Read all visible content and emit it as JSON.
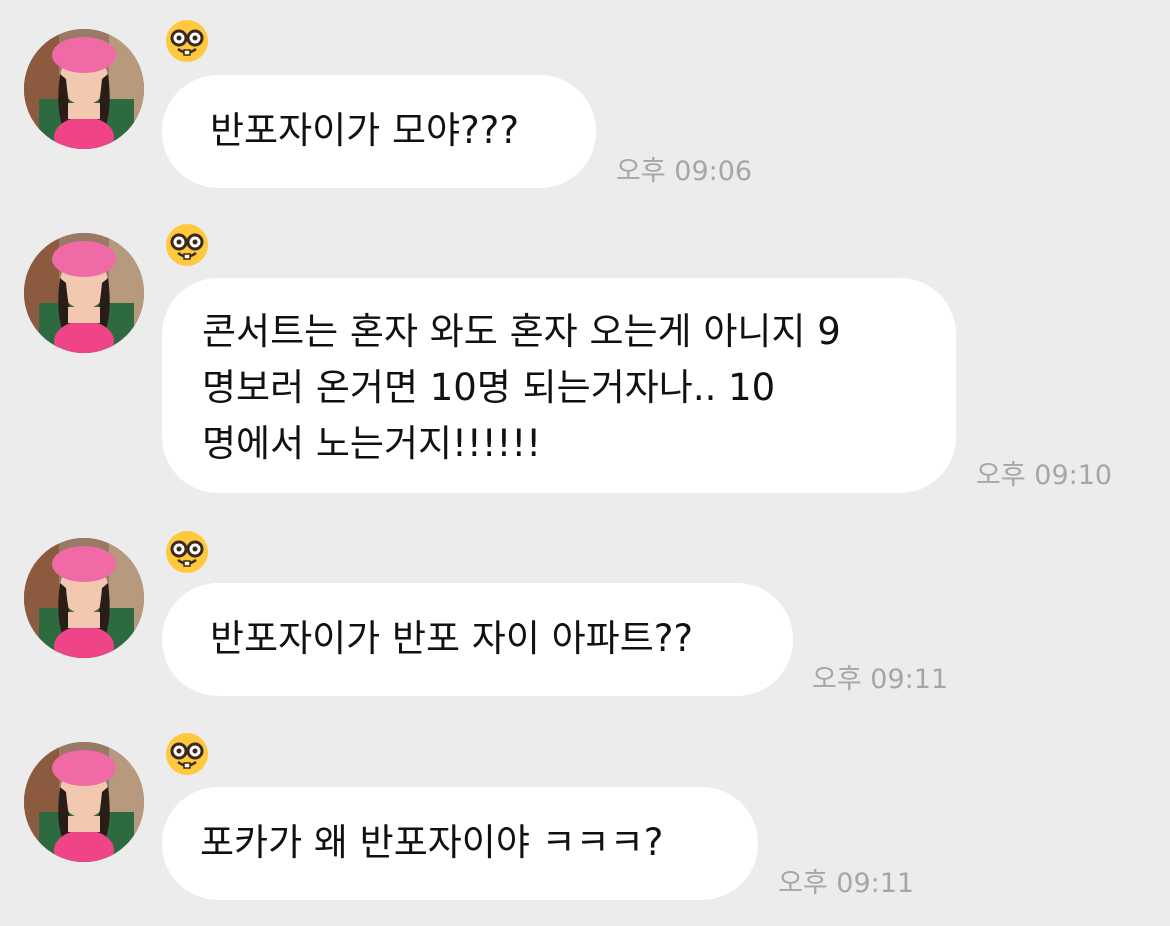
{
  "sender": {
    "emoji_icon": "nerd-face-icon",
    "avatar_icon": "profile-photo-avatar"
  },
  "messages": [
    {
      "text": "반포자이가 모야???",
      "time": "오후 09:06"
    },
    {
      "text": "콘서트는 혼자 와도 혼자 오는게 아니지 9\n명보러 온거면 10명 되는거자나.. 10\n명에서 노는거지!!!!!!",
      "time": "오후 09:10"
    },
    {
      "text": "반포자이가 반포 자이 아파트??",
      "time": "오후 09:11"
    },
    {
      "text": "포카가 왜 반포자이야 ㅋㅋㅋ?",
      "time": "오후 09:11"
    }
  ],
  "colors": {
    "background": "#ececec",
    "bubble": "#ffffff",
    "text": "#111111",
    "timestamp": "#a6a6a6"
  }
}
